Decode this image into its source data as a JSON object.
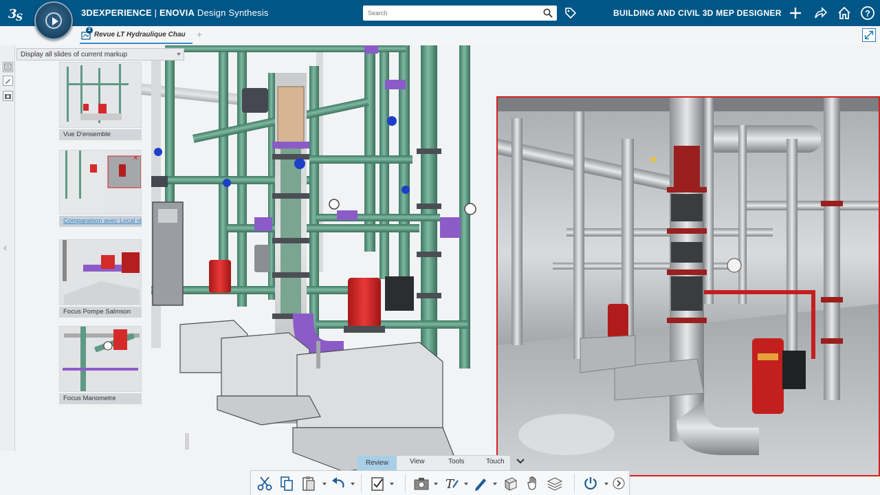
{
  "header": {
    "brand_bold": "3DEXPERIENCE",
    "brand_sep": " | ",
    "brand_app": "ENOVIA",
    "brand_app_rest": " Design Synthesis",
    "search_placeholder": "Search",
    "role": "BUILDING AND CIVIL 3D MEP DESIGNER"
  },
  "tab": {
    "label": "Revue LT Hydraulique Chau",
    "badge": "2"
  },
  "markup": {
    "select_value": "Display all slides of current markup"
  },
  "slides": [
    {
      "label": "Vue D'ensemble",
      "link": false
    },
    {
      "label": "Comparaison avec Local réel",
      "link": true
    },
    {
      "label": "Focus Pompe Salmson",
      "link": false
    },
    {
      "label": "Focus Manometre",
      "link": false
    }
  ],
  "action_bar": {
    "tabs": [
      "Review",
      "View",
      "Tools",
      "Touch"
    ],
    "active_tab": "Review"
  },
  "colors": {
    "header_bg": "#005686",
    "pipe_green": "#5e9a84",
    "pump_red": "#d42a2a",
    "flange_purple": "#8b5cc7",
    "frame_red": "#d32020"
  }
}
